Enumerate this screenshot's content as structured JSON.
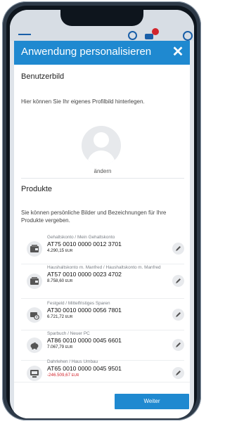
{
  "modal": {
    "title": "Anwendung personalisieren",
    "close_icon": "✕"
  },
  "profile": {
    "heading": "Benutzerbild",
    "description": "Hier können Sie Ihr eigenes Profilbild hinterlegen.",
    "change_label": "ändern"
  },
  "products": {
    "heading": "Produkte",
    "description": "Sie können persönliche Bilder und Bezeichnungen für Ihre Produkte vergeben.",
    "items": [
      {
        "subtitle": "Gehaltskonto / Mein Gehaltskonto",
        "iban": "AT75 0010 0000 0012 3701",
        "balance": "4.290,15",
        "currency": "EUR",
        "icon": "wallet-icon"
      },
      {
        "subtitle": "Haushaltskonto m. Manfred / Haushaltskonto m. Manfred",
        "iban": "AT57 0010 0000 0023 4702",
        "balance": "8.758,60",
        "currency": "EUR",
        "icon": "wallet-icon"
      },
      {
        "subtitle": "Festgeld / Mittelfristiges Sparen",
        "iban": "AT30 0010 0000 0056 7801",
        "balance": "6.721,72",
        "currency": "EUR",
        "icon": "savings-clock-icon"
      },
      {
        "subtitle": "Sparbuch / Neuer PC",
        "iban": "AT86 0010 0000 0045 6601",
        "balance": "7.067,79",
        "currency": "EUR",
        "icon": "piggy-bank-icon"
      },
      {
        "subtitle": "Dahrlehen / Haus Umbau",
        "iban": "AT65 0010 0000 0045 9501",
        "balance": "-246.509,67",
        "currency": "EUR",
        "icon": "loan-icon"
      }
    ]
  },
  "footer": {
    "next_label": "Weiter"
  },
  "colors": {
    "accent": "#1f89d0",
    "negative": "#d2252d"
  }
}
